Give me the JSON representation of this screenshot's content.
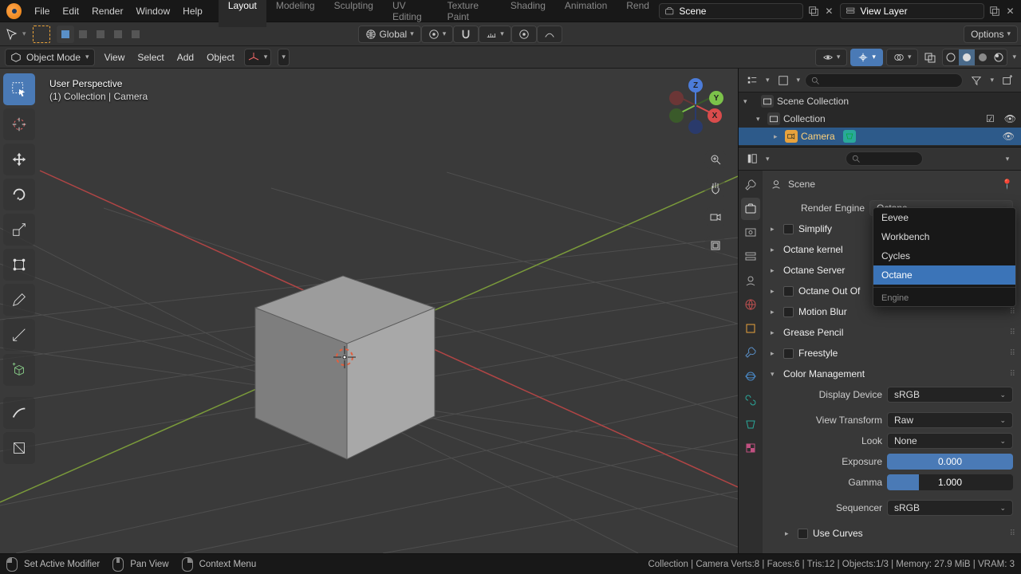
{
  "menubar": {
    "items": [
      "File",
      "Edit",
      "Render",
      "Window",
      "Help"
    ]
  },
  "workspace_tabs": {
    "items": [
      "Layout",
      "Modeling",
      "Sculpting",
      "UV Editing",
      "Texture Paint",
      "Shading",
      "Animation",
      "Rend"
    ],
    "active": 0
  },
  "topbar": {
    "scene_label": "Scene",
    "viewlayer_label": "View Layer"
  },
  "toolbar2": {
    "orientation": "Global",
    "options_label": "Options"
  },
  "toolbar3": {
    "mode": "Object Mode",
    "items": [
      "View",
      "Select",
      "Add",
      "Object"
    ]
  },
  "viewport": {
    "header_l1": "User Perspective",
    "header_l2": "(1) Collection | Camera",
    "axes": {
      "x": "X",
      "y": "Y",
      "z": "Z"
    }
  },
  "outliner": {
    "root": "Scene Collection",
    "collection": "Collection",
    "items": [
      {
        "name": "Camera",
        "selected": true
      }
    ]
  },
  "properties": {
    "crumb": "Scene",
    "render_engine_label": "Render Engine",
    "render_engine_value": "Octane",
    "engine_options": [
      "Eevee",
      "Workbench",
      "Cycles",
      "Octane"
    ],
    "engine_options_heading": "Engine",
    "panels": {
      "simplify": "Simplify",
      "octane_kernel": "Octane kernel",
      "octane_server": "Octane Server",
      "octane_outof": "Octane Out Of",
      "motion_blur": "Motion Blur",
      "grease": "Grease Pencil",
      "freestyle": "Freestyle",
      "color_mgmt": "Color Management",
      "use_curves": "Use Curves"
    },
    "color_mgmt": {
      "display_device_label": "Display Device",
      "display_device": "sRGB",
      "view_transform_label": "View Transform",
      "view_transform": "Raw",
      "look_label": "Look",
      "look": "None",
      "exposure_label": "Exposure",
      "exposure": "0.000",
      "gamma_label": "Gamma",
      "gamma": "1.000",
      "sequencer_label": "Sequencer",
      "sequencer": "sRGB"
    }
  },
  "statusbar": {
    "left1": "Set Active Modifier",
    "left2": "Pan View",
    "left3": "Context Menu",
    "right": "Collection | Camera   Verts:8 | Faces:6 | Tris:12 | Objects:1/3 | Memory: 27.9 MiB | VRAM: 3"
  }
}
